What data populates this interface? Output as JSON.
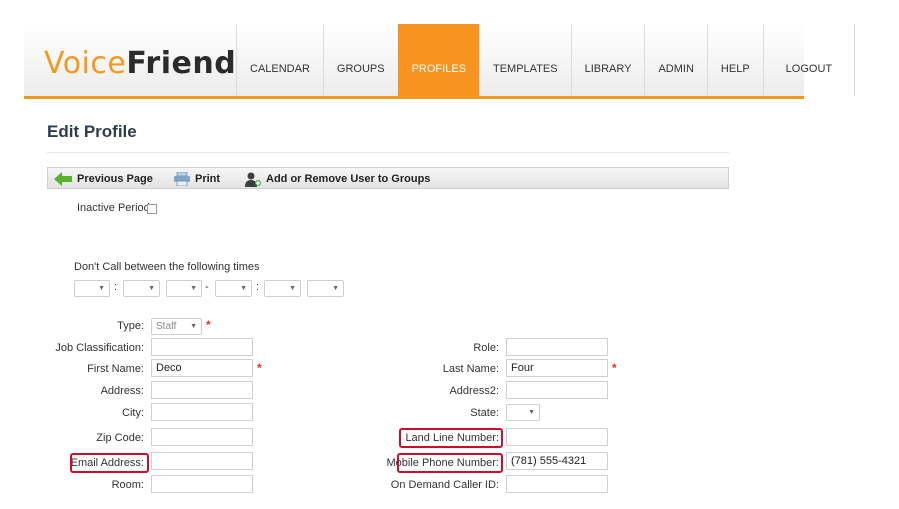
{
  "logo": {
    "part1": "Voice",
    "part2": "Friend"
  },
  "nav": [
    "CALENDAR",
    "GROUPS",
    "PROFILES",
    "TEMPLATES",
    "LIBRARY",
    "ADMIN",
    "HELP",
    "LOGOUT"
  ],
  "active_nav": "PROFILES",
  "page_title": "Edit Profile",
  "toolbar": {
    "previous": "Previous Page",
    "print": "Print",
    "groups": "Add or Remove User to Groups"
  },
  "inactive_label": "Inactive Period",
  "dont_call_label": "Don't Call between the following times",
  "time_separators": [
    ":",
    "-",
    ":"
  ],
  "form": {
    "type_label": "Type:",
    "type_value": "Staff",
    "job_label": "Job Classification:",
    "first_label": "First Name:",
    "first_value": "Deco",
    "address_label": "Address:",
    "city_label": "City:",
    "zip_label": "Zip Code:",
    "email_label": "Email Address:",
    "room_label": "Room:",
    "role_label": "Role:",
    "last_label": "Last Name:",
    "last_value": "Four",
    "address2_label": "Address2:",
    "state_label": "State:",
    "landline_label": "Land Line Number:",
    "mobile_label": "Mobile Phone Number:",
    "mobile_value": "(781) 555-4321",
    "ondemand_label": "On Demand Caller ID:"
  },
  "required_mark": "*",
  "colors": {
    "accent": "#f8931f",
    "highlight": "#c8102e",
    "required": "#e0301e"
  }
}
